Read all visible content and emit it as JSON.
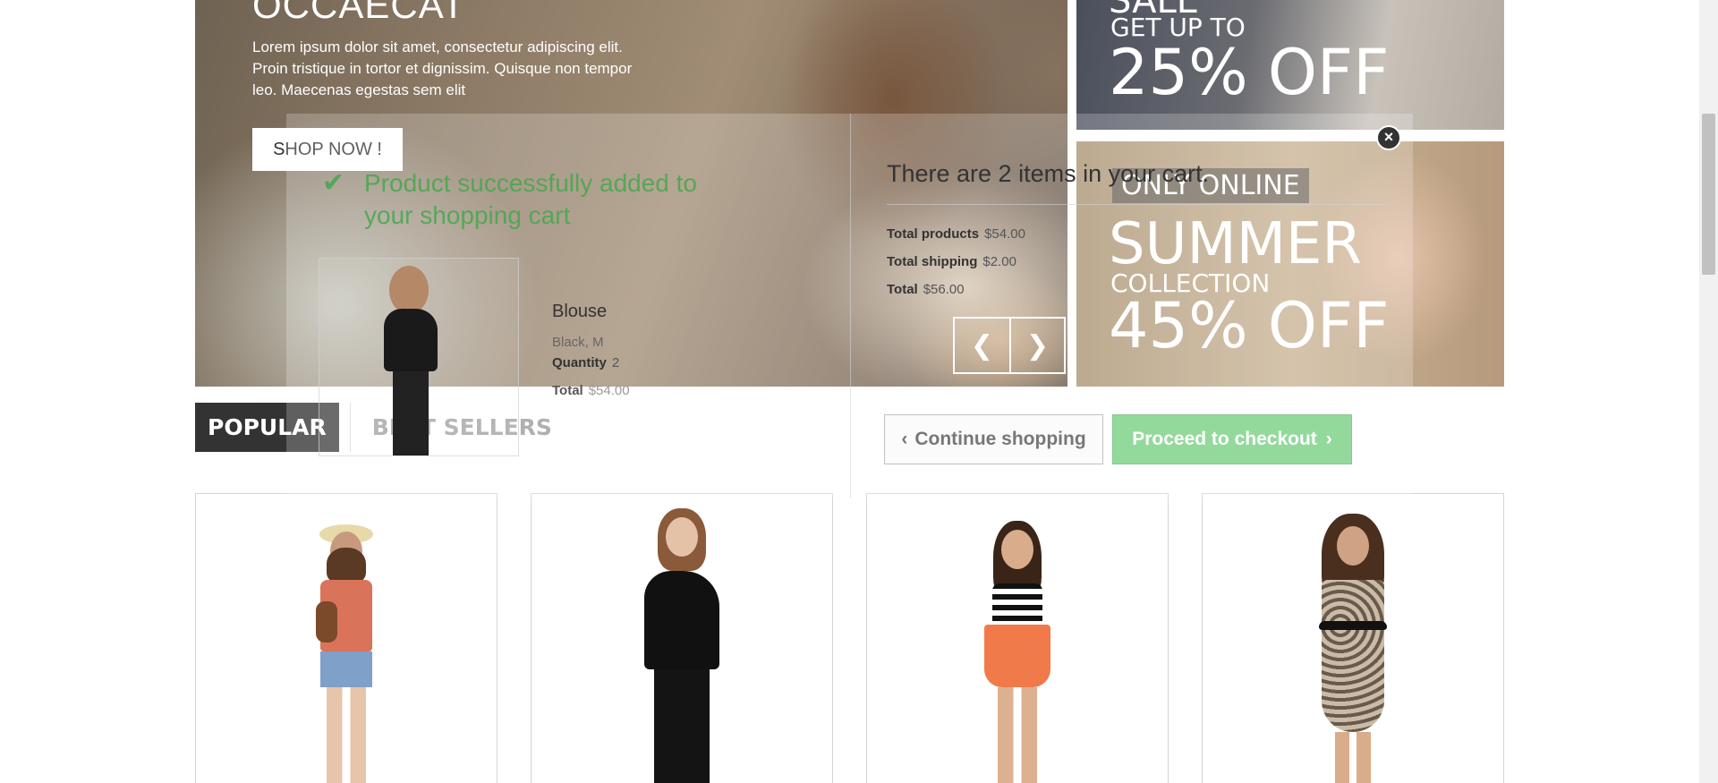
{
  "hero": {
    "title": "OCCAECAT",
    "text": "Lorem ipsum dolor sit amet, consectetur adipiscing elit. Proin tristique in tortor et dignissim. Quisque non tempor leo. Maecenas egestas sem elit",
    "button_label": "SHOP NOW !"
  },
  "banners": {
    "top": {
      "line1": "SALE",
      "line2": "GET UP TO",
      "line3": "25% OFF"
    },
    "bottom": {
      "line1": "ONLY ONLINE",
      "line2": "SUMMER",
      "line3": "COLLECTION",
      "line4": "45% OFF"
    }
  },
  "tabs": [
    {
      "label": "POPULAR"
    },
    {
      "label": "BEST SELLERS"
    }
  ],
  "cart_modal": {
    "success_message": "Product successfully added to your shopping cart",
    "product": {
      "name": "Blouse",
      "attributes": "Black, M",
      "quantity_label": "Quantity",
      "quantity": "2",
      "total_label": "Total",
      "total": "$54.00"
    },
    "cart_count_text": "There are 2 items in your cart.",
    "summary": {
      "products_label": "Total products",
      "products_value": "$54.00",
      "shipping_label": "Total shipping",
      "shipping_value": "$2.00",
      "total_label": "Total",
      "total_value": "$56.00"
    },
    "continue_label": "Continue shopping",
    "checkout_label": "Proceed to checkout",
    "close_symbol": "×"
  },
  "icons": {
    "check": "check-icon",
    "prev": "chevron-left-icon",
    "next": "chevron-right-icon",
    "close": "close-icon"
  },
  "colors": {
    "success_green": "#46a74e",
    "checkout_green": "#94d99c",
    "tab_active_bg": "#333333"
  }
}
